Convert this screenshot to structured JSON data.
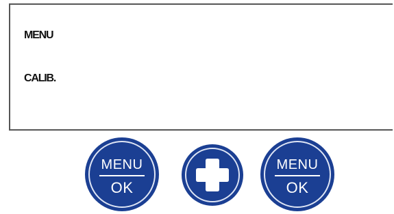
{
  "display": {
    "line1": "MENU",
    "line2": "CALIB."
  },
  "buttons": {
    "left": {
      "top_label": "MENU",
      "bottom_label": "OK"
    },
    "plus": {
      "icon": "plus-icon"
    },
    "right": {
      "top_label": "MENU",
      "bottom_label": "OK"
    }
  },
  "colors": {
    "button_blue": "#1b3f93",
    "ring_white": "#dfe6f5",
    "display_border": "#555555"
  }
}
